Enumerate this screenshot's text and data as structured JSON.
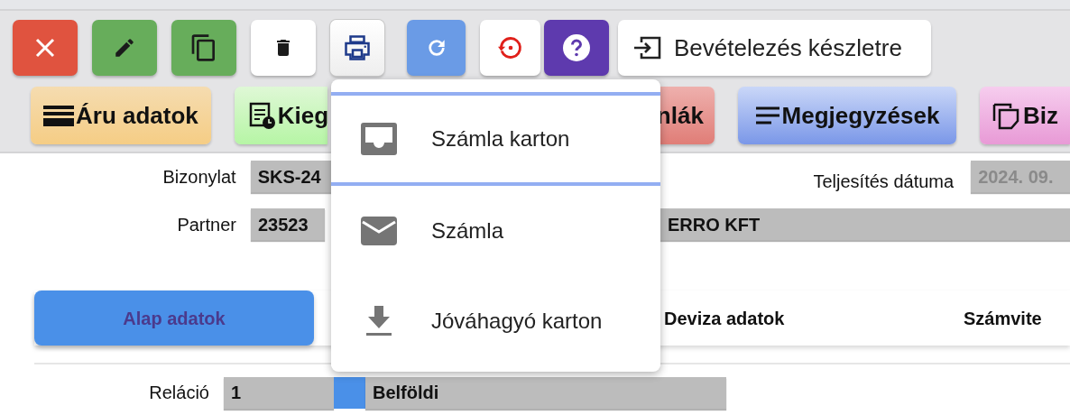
{
  "toolbar": {
    "icon_buttons": [
      {
        "kind": "close"
      },
      {
        "kind": "edit"
      },
      {
        "kind": "copy"
      },
      {
        "kind": "delete"
      },
      {
        "kind": "print",
        "expanded": true
      },
      {
        "kind": "refresh"
      },
      {
        "kind": "history"
      },
      {
        "kind": "help"
      }
    ],
    "action_button": {
      "label": "Bevételezés készletre"
    }
  },
  "section_buttons": [
    {
      "label": "Áru adatok",
      "kind": "goods"
    },
    {
      "label": "Kieg",
      "kind": "extra"
    },
    {
      "label": "nlák",
      "kind": "invoices"
    },
    {
      "label": "Megjegyzések",
      "kind": "notes"
    },
    {
      "label": "Biz",
      "kind": "docs"
    }
  ],
  "header_fields": {
    "document": {
      "label": "Bizonylat",
      "value": "SKS-24"
    },
    "partner": {
      "label": "Partner",
      "code": "23523",
      "name": "ERRO KFT"
    },
    "fulfillment_date": {
      "label": "Teljesítés dátuma",
      "value": "2024. 09."
    }
  },
  "tabs": [
    {
      "label": "Alap adatok",
      "selected": true
    },
    {
      "label": "Deviza adatok",
      "selected": false
    },
    {
      "label": "Számvite",
      "selected": false
    }
  ],
  "relation": {
    "label": "Reláció",
    "code": "1",
    "name": "Belföldi"
  },
  "print_menu": {
    "items": [
      {
        "label": "Számla karton",
        "kind": "tray",
        "selected": true
      },
      {
        "label": "Számla",
        "kind": "mail",
        "selected": false
      },
      {
        "label": "Jóváhagyó karton",
        "kind": "download",
        "selected": false
      }
    ]
  }
}
